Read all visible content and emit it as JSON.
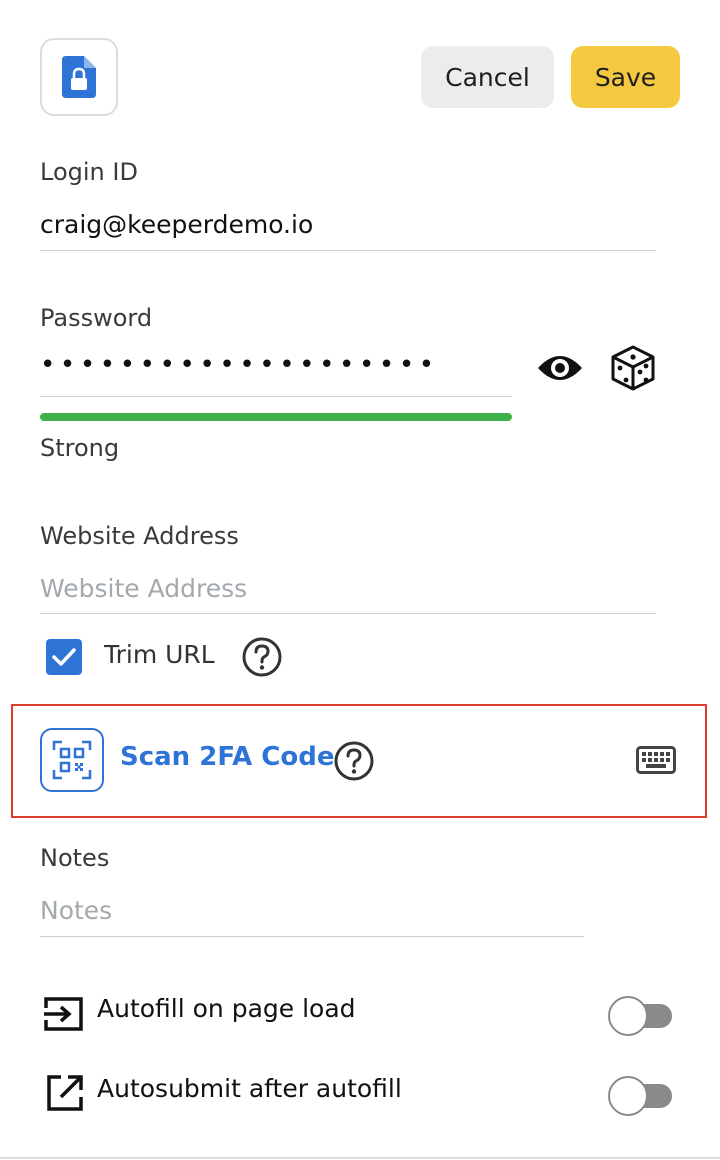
{
  "header": {
    "record_icon": "document-lock-icon",
    "cancel_label": "Cancel",
    "save_label": "Save"
  },
  "login": {
    "label": "Login ID",
    "value": "craig@keeperdemo.io"
  },
  "password": {
    "label": "Password",
    "masked_value": "••••••••••••••••••••",
    "strength_label": "Strong",
    "strength_level": 1.0,
    "show_icon": "eye-icon",
    "generate_icon": "dice-icon"
  },
  "website": {
    "label": "Website Address",
    "placeholder": "Website Address",
    "trim_url_label": "Trim URL",
    "trim_url_checked": true
  },
  "twofa": {
    "label": "Scan 2FA Code",
    "qr_icon": "qr-code-icon",
    "keyboard_icon": "keyboard-icon"
  },
  "notes": {
    "label": "Notes",
    "placeholder": "Notes"
  },
  "options": {
    "autofill_label": "Autofill on page load",
    "autofill_enabled": false,
    "autosubmit_label": "Autosubmit after autofill",
    "autosubmit_enabled": false
  },
  "colors": {
    "accent_blue": "#2e73d6",
    "save_yellow": "#f5c93f",
    "strength_green": "#3db04a",
    "focus_red": "#dd3d2a"
  }
}
